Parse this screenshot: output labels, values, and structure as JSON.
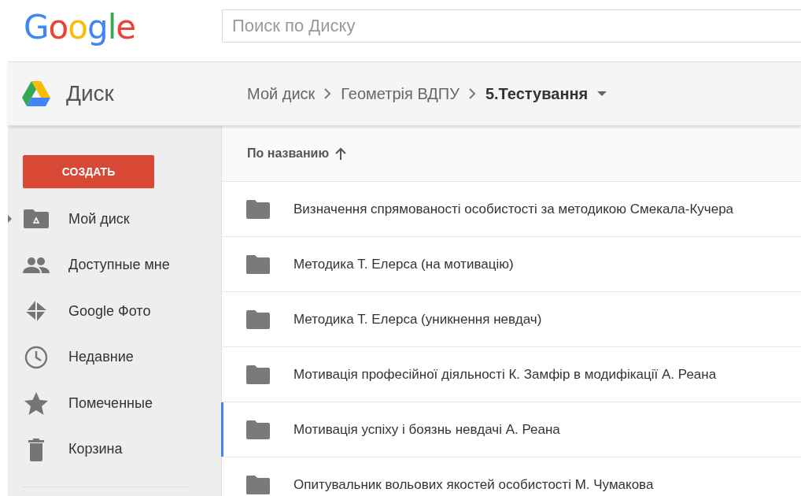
{
  "header": {
    "logo": "Google",
    "search": {
      "placeholder": "Поиск по Диску"
    }
  },
  "app_bar": {
    "title": "Диск",
    "breadcrumb": [
      {
        "label": "Мой диск",
        "current": false
      },
      {
        "label": "Геометрія ВДПУ",
        "current": false
      },
      {
        "label": "5.Тестування",
        "current": true
      }
    ]
  },
  "sidebar": {
    "create_button": "СОЗДАТЬ",
    "items": [
      {
        "label": "Мой диск",
        "kind": "drive",
        "expandable": true
      },
      {
        "label": "Доступные мне",
        "kind": "shared",
        "expandable": false
      },
      {
        "label": "Google Фото",
        "kind": "photos",
        "expandable": false
      },
      {
        "label": "Недавние",
        "kind": "recent",
        "expandable": false
      },
      {
        "label": "Помеченные",
        "kind": "starred",
        "expandable": false
      },
      {
        "label": "Корзина",
        "kind": "trash",
        "expandable": false
      }
    ]
  },
  "file_list": {
    "sort_label": "По названию",
    "rows": [
      {
        "name": "Визначення спрямованості особистості за методикою Смекала-Кучера",
        "selected": false
      },
      {
        "name": "Методика Т. Елерса (на мотивацію)",
        "selected": false
      },
      {
        "name": "Методика Т. Елерса (уникнення невдач)",
        "selected": false
      },
      {
        "name": "Мотивація професійної діяльності К. Замфір в модифікації А. Реана",
        "selected": false
      },
      {
        "name": "Мотивація успіху і боязнь невдачі А. Реана",
        "selected": true
      },
      {
        "name": "Опитувальник вольових якостей особистості М. Чумакова",
        "selected": false
      }
    ]
  }
}
